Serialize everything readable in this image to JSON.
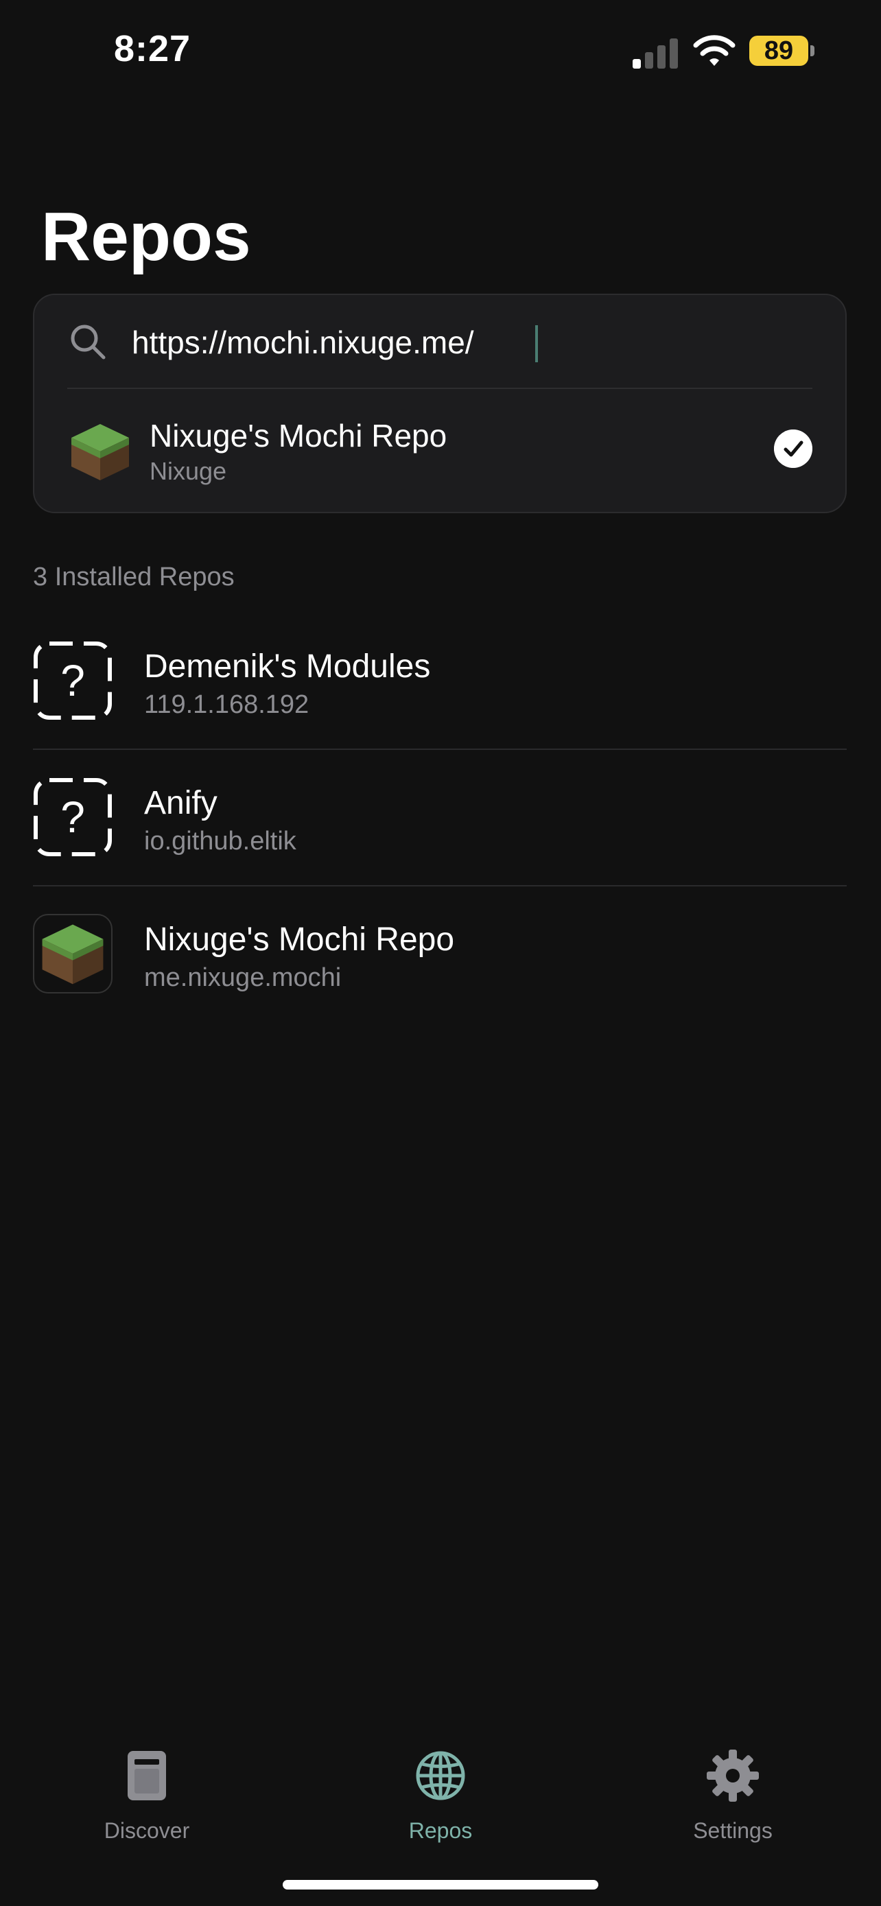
{
  "status_bar": {
    "time": "8:27",
    "battery": "89"
  },
  "page": {
    "title": "Repos"
  },
  "search": {
    "value": "https://mochi.nixuge.me/",
    "result": {
      "title": "Nixuge's Mochi Repo",
      "subtitle": "Nixuge",
      "icon": "grass-block-icon",
      "selected": true
    }
  },
  "installed": {
    "header": "3 Installed Repos",
    "repos": [
      {
        "title": "Demenik's Modules",
        "subtitle": "119.1.168.192",
        "icon": "placeholder-question-icon"
      },
      {
        "title": "Anify",
        "subtitle": "io.github.eltik",
        "icon": "placeholder-question-icon"
      },
      {
        "title": "Nixuge's Mochi Repo",
        "subtitle": "me.nixuge.mochi",
        "icon": "grass-block-icon"
      }
    ]
  },
  "tabs": [
    {
      "label": "Discover",
      "icon": "book-icon",
      "active": false
    },
    {
      "label": "Repos",
      "icon": "globe-icon",
      "active": true
    },
    {
      "label": "Settings",
      "icon": "gear-icon",
      "active": false
    }
  ],
  "colors": {
    "background": "#111111",
    "card": "#1c1c1e",
    "secondary_text": "#8e8e93",
    "accent": "#7fb3aa",
    "battery": "#f5cf3a"
  }
}
